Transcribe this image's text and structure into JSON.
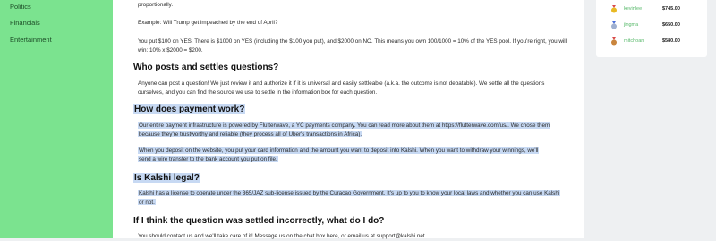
{
  "sidebar": {
    "items": [
      {
        "label": "Politics"
      },
      {
        "label": "Financials"
      },
      {
        "label": "Entertainment"
      }
    ]
  },
  "content": {
    "proportionally": "proportionally.",
    "example": "Example: Will Trump get impeached by the end of April?",
    "example_p1": "You put $100 on YES. There is $1000 on YES (including the $100 you put), and $2000 on NO. This means you own 100/1000 = 10% of the YES pool. If you're right, you will",
    "example_p2": "win: 10% x $2000 = $200.",
    "h_who": "Who posts and settles questions?",
    "who_p1": "Anyone can post a question! We just review it and authorize it if it is universal and easily settleable (a.k.a. the outcome is not debatable). We settle all the questions",
    "who_p2": "ourselves, and you can find the source we use to settle in the information box for each question.",
    "h_payment": "How does payment work?",
    "pay_p1": "Our entire payment infrastructure is powered by Flutterwave, a YC payments company. You can read more about them at https://flutterwave.com/us/. We chose them",
    "pay_p2": "because they're trustworthy and reliable (they process all of Uber's transactions in Africa).",
    "dep_p1": "When you deposit on the website, you put your card information and the amount you want to deposit into Kalshi. When you want to withdraw your winnings, we'll",
    "dep_p2": "send a wire transfer to the bank account you put on file.",
    "h_legal": "Is Kalshi legal?",
    "legal_p1": "Kalshi has a license to operate under the 365/JAZ sub-license issued by the Curacao Government. It's up to you to know your local laws and whether you can use Kalshi",
    "legal_p2": "or not.",
    "h_incorrect": "If I think the question was settled incorrectly, what do I do?",
    "incorrect_p1": "You should contact us and we'll take care of it! Message us on the chat box here, or email us at support@kalshi.net."
  },
  "leaderboard": {
    "rows": [
      {
        "name": "kevinlee",
        "amount": "$745.00",
        "medal_color": "#e8b923",
        "medal_icon": "medal-gold-icon"
      },
      {
        "name": "jingma",
        "amount": "$650.00",
        "medal_color": "#9fb0d0",
        "medal_icon": "medal-silver-icon"
      },
      {
        "name": "mitchoan",
        "amount": "$580.00",
        "medal_color": "#c9853d",
        "medal_icon": "medal-bronze-icon"
      }
    ]
  },
  "colors": {
    "sidebar_bg": "#7be38f",
    "highlight": "#c7d9f3",
    "accent_name": "#59b96b"
  }
}
